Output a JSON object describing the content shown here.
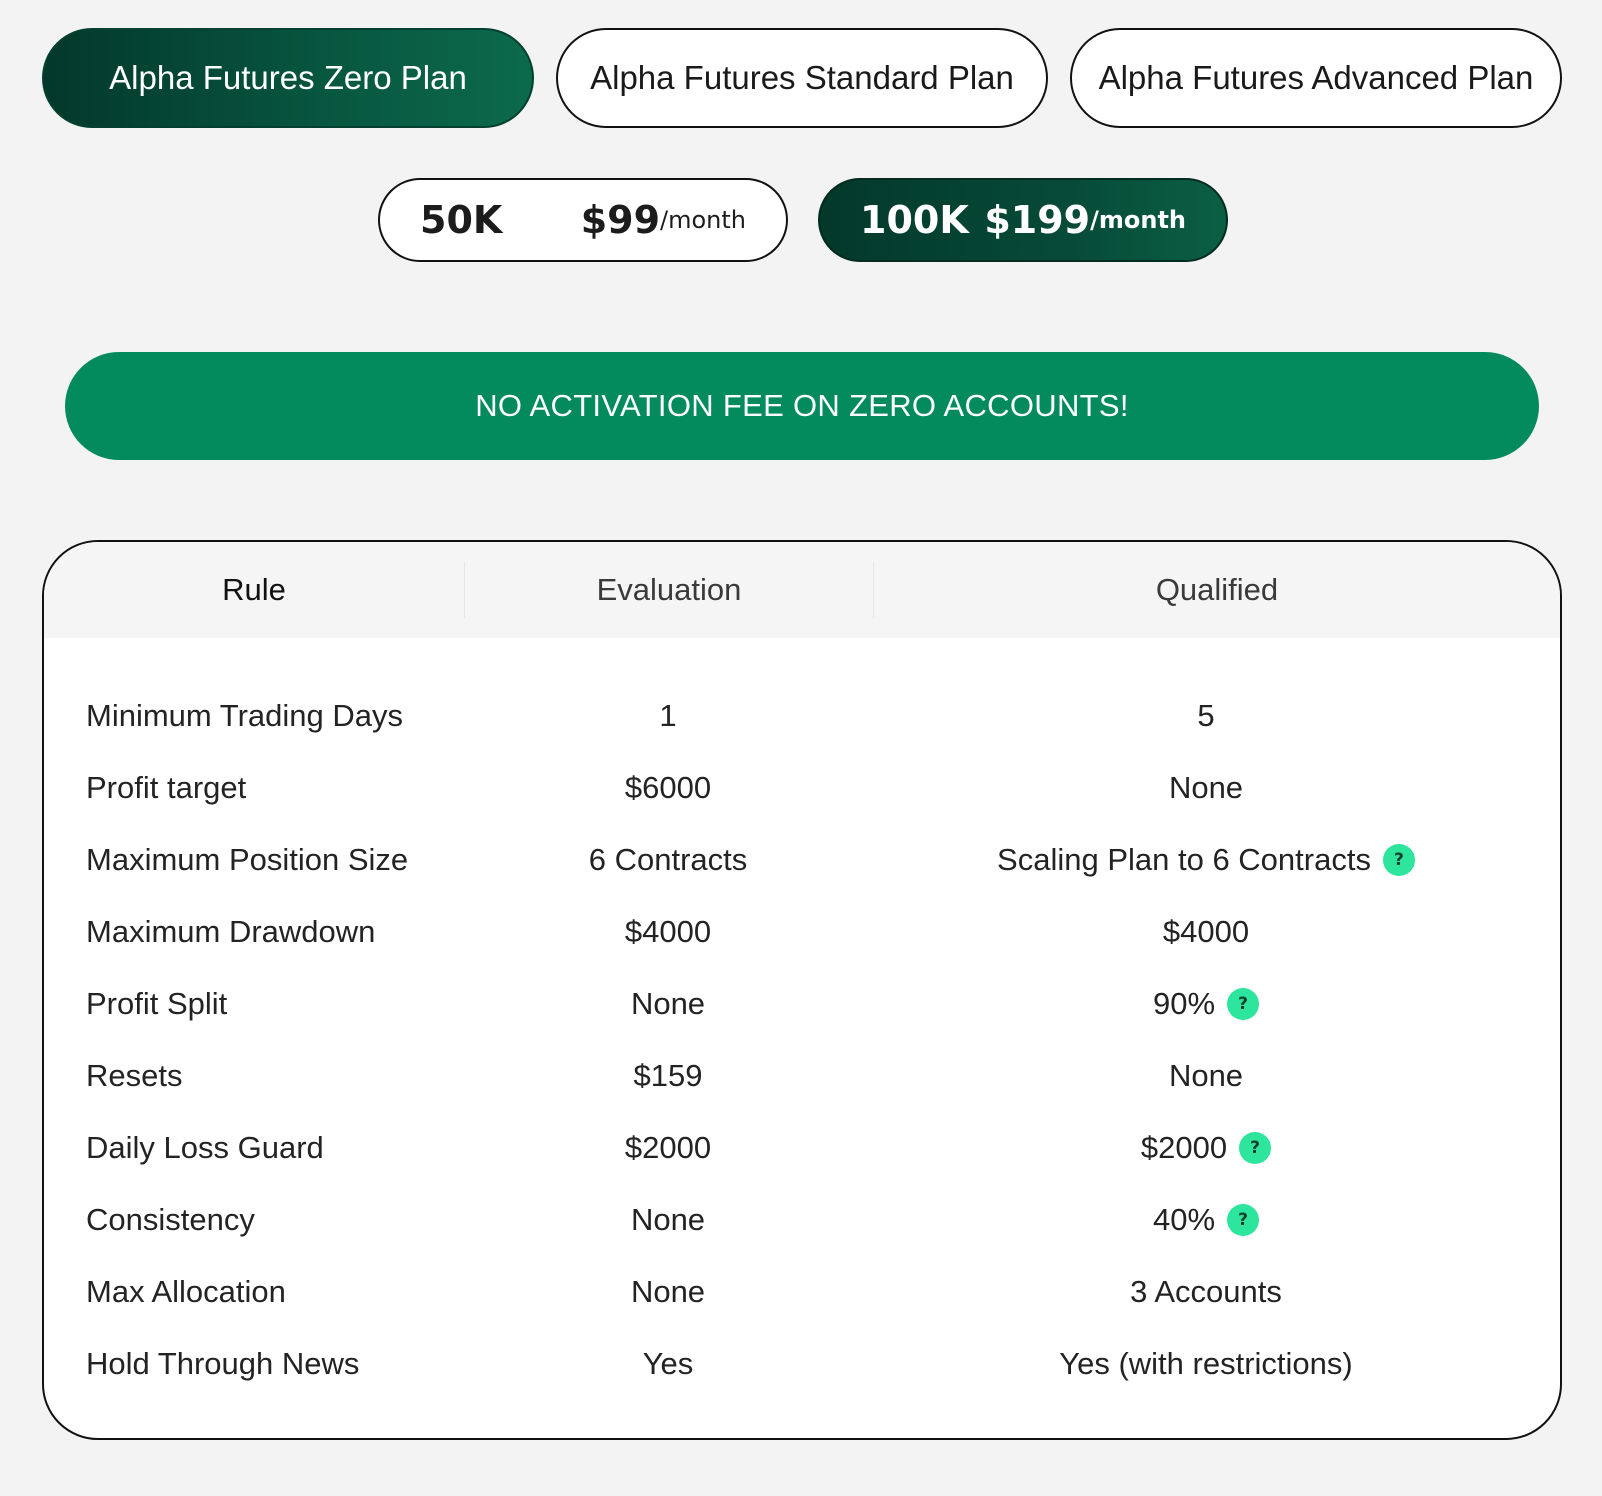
{
  "plan_tabs": [
    {
      "label": "Alpha Futures Zero Plan",
      "active": true
    },
    {
      "label": "Alpha Futures Standard Plan",
      "active": false
    },
    {
      "label": "Alpha Futures Advanced Plan",
      "active": false
    }
  ],
  "sizes": [
    {
      "amount": "50K",
      "price": "$99",
      "period": "/month",
      "active": false
    },
    {
      "amount": "100K",
      "price": "$199",
      "period": "/month",
      "active": true
    }
  ],
  "banner": "NO ACTIVATION FEE ON ZERO ACCOUNTS!",
  "table": {
    "headers": {
      "rule": "Rule",
      "evaluation": "Evaluation",
      "qualified": "Qualified"
    },
    "rows": [
      {
        "rule": "Minimum Trading Days",
        "evaluation": "1",
        "qualified": "5",
        "help": false
      },
      {
        "rule": "Profit target",
        "evaluation": "$6000",
        "qualified": "None",
        "help": false
      },
      {
        "rule": "Maximum Position Size",
        "evaluation": "6 Contracts",
        "qualified": "Scaling Plan to 6 Contracts",
        "help": true
      },
      {
        "rule": "Maximum Drawdown",
        "evaluation": "$4000",
        "qualified": "$4000",
        "help": false
      },
      {
        "rule": "Profit Split",
        "evaluation": "None",
        "qualified": "90%",
        "help": true
      },
      {
        "rule": "Resets",
        "evaluation": "$159",
        "qualified": "None",
        "help": false
      },
      {
        "rule": "Daily Loss Guard",
        "evaluation": "$2000",
        "qualified": "$2000",
        "help": true
      },
      {
        "rule": "Consistency",
        "evaluation": "None",
        "qualified": "40%",
        "help": true
      },
      {
        "rule": "Max Allocation",
        "evaluation": "None",
        "qualified": "3 Accounts",
        "help": false
      },
      {
        "rule": "Hold Through News",
        "evaluation": "Yes",
        "qualified": "Yes (with restrictions)",
        "help": false
      }
    ],
    "help_icon_glyph": "?"
  },
  "colors": {
    "active_dark_green": "#064a37",
    "banner_green": "#038a5d",
    "help_icon_mint": "#2ee59d",
    "page_bg": "#f3f3f3"
  }
}
